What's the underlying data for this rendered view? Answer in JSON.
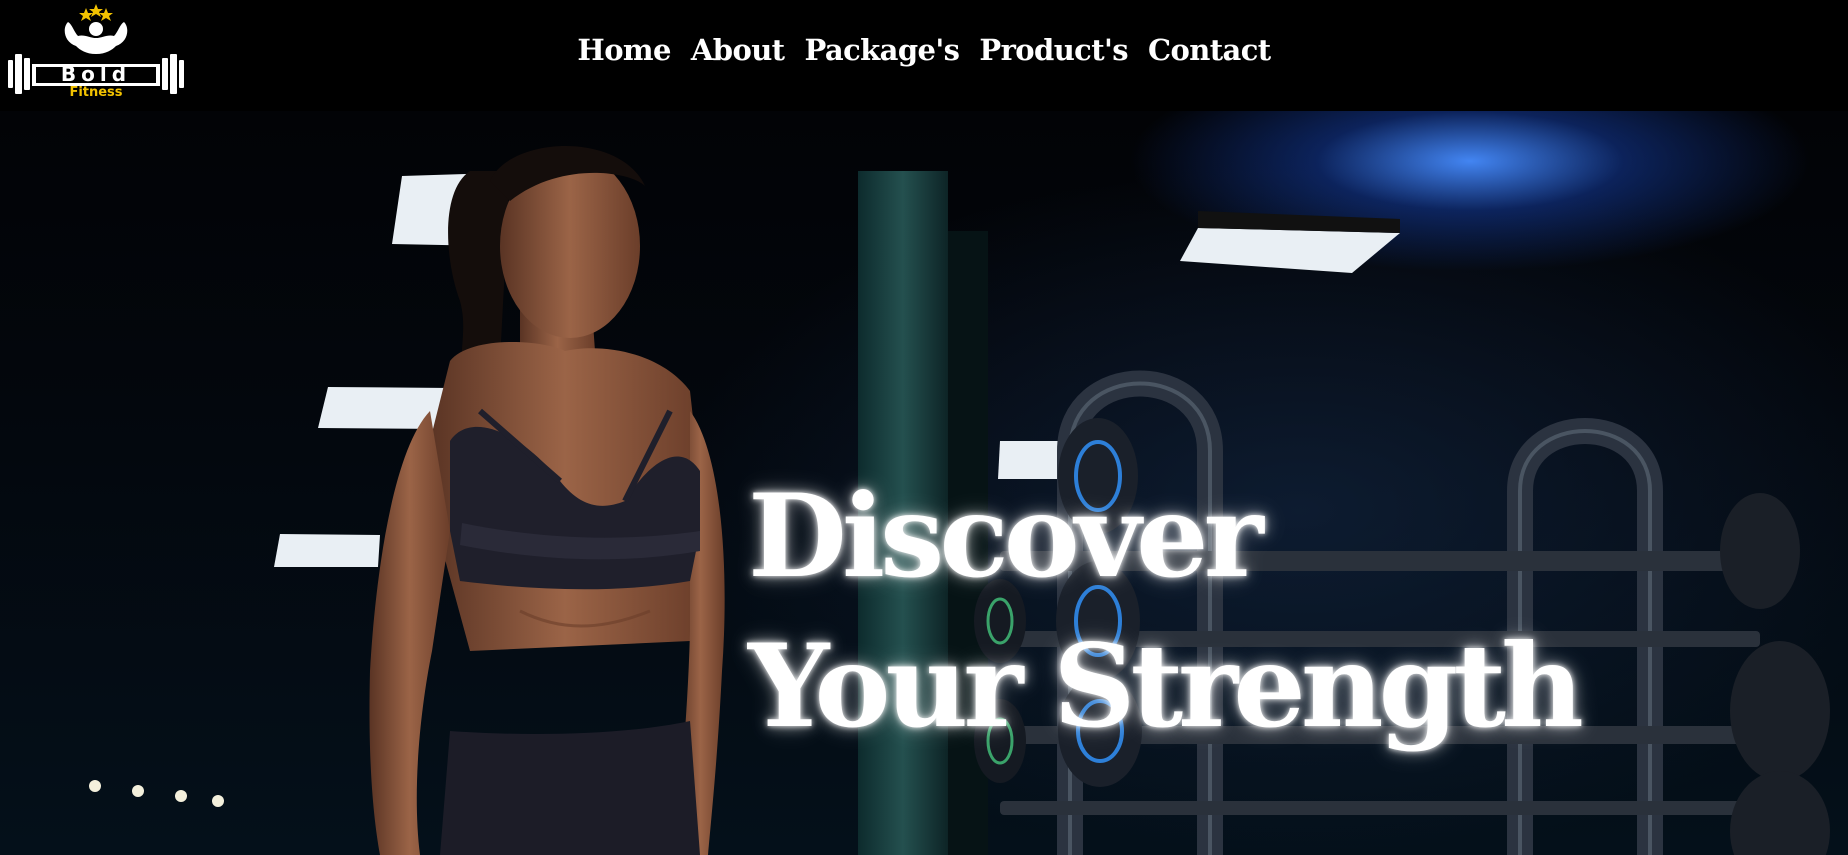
{
  "brand": {
    "logo_text": "Bold",
    "logo_subtext": "Fitness",
    "accent_color": "#f2c200"
  },
  "nav": {
    "items": [
      {
        "label": "Home"
      },
      {
        "label": "About"
      },
      {
        "label": "Package's"
      },
      {
        "label": "Product's"
      },
      {
        "label": "Contact"
      }
    ]
  },
  "hero": {
    "headline_line1": "Discover",
    "headline_line2": "Your Strength",
    "image_description_icon": "gym-woman-photo"
  }
}
